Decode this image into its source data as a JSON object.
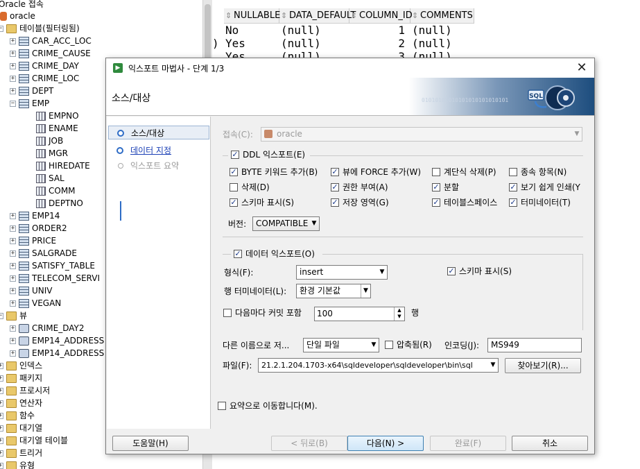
{
  "tree": {
    "top_label": "Oracle 접속",
    "connection": "oracle",
    "tables_folder": "테이블(필터링됨)",
    "tables": [
      "CAR_ACC_LOC",
      "CRIME_CAUSE",
      "CRIME_DAY",
      "CRIME_LOC",
      "DEPT",
      "EMP"
    ],
    "emp_columns": [
      "EMPNO",
      "ENAME",
      "JOB",
      "MGR",
      "HIREDATE",
      "SAL",
      "COMM",
      "DEPTNO"
    ],
    "more_tables": [
      "EMP14",
      "ORDER2",
      "PRICE",
      "SALGRADE",
      "SATISFY_TABLE",
      "TELECOM_SERVI",
      "UNIV",
      "VEGAN"
    ],
    "views_folder": "뷰",
    "views": [
      "CRIME_DAY2",
      "EMP14_ADDRESS",
      "EMP14_ADDRESS"
    ],
    "folders": [
      "인덱스",
      "패키지",
      "프로시저",
      "연산자",
      "함수",
      "대기열",
      "대기열 테이블",
      "트리거",
      "유형"
    ]
  },
  "grid": {
    "headers": [
      "NULLABLE",
      "DATA_DEFAULT",
      "COLUMN_ID",
      "COMMENTS"
    ],
    "rows": [
      {
        "prefix": "",
        "nullable": "No",
        "default": "(null)",
        "id": "1",
        "comments": "(null)"
      },
      {
        "prefix": ")",
        "nullable": "Yes",
        "default": "(null)",
        "id": "2",
        "comments": "(null)"
      },
      {
        "prefix": "",
        "nullable": "Yes",
        "default": "(null)",
        "id": "3",
        "comments": "(null)"
      }
    ]
  },
  "dialog": {
    "title": "익스포트 마법사 - 단계 1/3",
    "heading": "소스/대상",
    "banner_bits": "01010101010101010101010101",
    "logo_text": "SQL",
    "steps": [
      {
        "label": "소스/대상",
        "state": "active"
      },
      {
        "label": "데이터 지정",
        "state": "link"
      },
      {
        "label": "익스포트 요약",
        "state": "disabled"
      }
    ],
    "connection_label": "접속(C):",
    "connection_value": "oracle",
    "ddl_export": {
      "label": "DDL 익스포트(E)",
      "checked": true
    },
    "ddl_options": [
      {
        "label": "BYTE 키워드 추가(B)",
        "checked": true
      },
      {
        "label": "뷰에 FORCE 추가(W)",
        "checked": true
      },
      {
        "label": "계단식 삭제(P)",
        "checked": false
      },
      {
        "label": "종속 항목(N)",
        "checked": false
      },
      {
        "label": "삭제(D)",
        "checked": false
      },
      {
        "label": "권한 부여(A)",
        "checked": true
      },
      {
        "label": "분할",
        "checked": true
      },
      {
        "label": "보기 쉽게 인쇄(Y",
        "checked": true
      },
      {
        "label": "스키마 표시(S)",
        "checked": true
      },
      {
        "label": "저장 영역(G)",
        "checked": true
      },
      {
        "label": "테이블스페이스",
        "checked": true
      },
      {
        "label": "터미네이터(T)",
        "checked": true
      }
    ],
    "version_label": "버전:",
    "version_value": "COMPATIBLE",
    "data_export": {
      "label": "데이터 익스포트(O)",
      "checked": true
    },
    "format_label": "형식(F):",
    "format_value": "insert",
    "data_schema": {
      "label": "스키마 표시(S)",
      "checked": true
    },
    "row_term_label": "행 터미네이터(L):",
    "row_term_value": "환경 기본값",
    "commit_every": {
      "label": "다음마다 커밋 포함",
      "checked": false
    },
    "commit_value": "100",
    "commit_unit": "행",
    "save_as_label": "다른 이름으로 저...",
    "save_as_value": "단일 파일",
    "compressed": {
      "label": "압축됨(R)",
      "checked": false
    },
    "encoding_label": "인코딩(J):",
    "encoding_value": "MS949",
    "file_label": "파일(F):",
    "file_value": "21.2.1.204.1703-x64\\sqldeveloper\\sqldeveloper\\bin\\sql",
    "browse_label": "찾아보기(R)...",
    "summary": {
      "label": "요약으로 이동합니다(M).",
      "checked": false
    },
    "buttons": {
      "help": "도움말(H)",
      "back": "< 뒤로(B)",
      "next": "다음(N) >",
      "finish": "완료(F)",
      "cancel": "취소"
    }
  }
}
